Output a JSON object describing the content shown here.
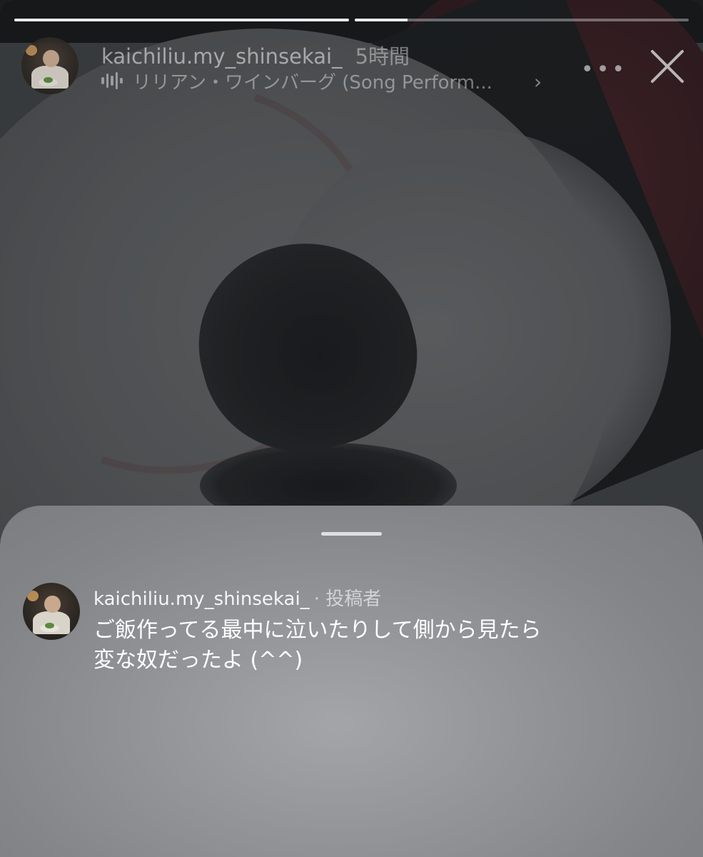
{
  "progress": [
    {
      "fill": 1.0
    },
    {
      "fill": 0.16
    }
  ],
  "story": {
    "background": "blurred close-up photo of a sleeping cat",
    "username": "kaichiliu.my_shinsekai_",
    "time_ago": "5時間",
    "music_label": "リリアン・ワインバーグ (Song Perform...",
    "more_label": "•••"
  },
  "comment": {
    "username": "kaichiliu.my_shinsekai_",
    "role_label": "· 投稿者",
    "lines": [
      "ご飯作ってる最中に泣いたりして側から見たら",
      "変な奴だったよ (^^)"
    ]
  },
  "icons": [
    "music-wave-icon",
    "chevron-right-icon",
    "more-options-icon",
    "close-icon",
    "avatar"
  ],
  "colors": {
    "sheet": "#8d8f92",
    "text": "#ffffff",
    "progress_active": "#e9eaeb"
  }
}
